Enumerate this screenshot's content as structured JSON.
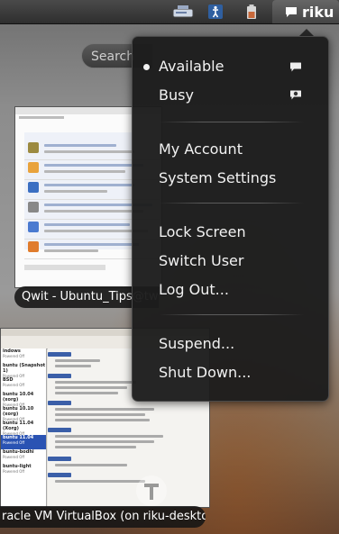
{
  "panel": {
    "user_name": "riku",
    "icons": [
      "network-icon",
      "accessibility-icon",
      "battery-icon",
      "chat-bubble-icon"
    ]
  },
  "search": {
    "placeholder": "Search"
  },
  "windows": [
    {
      "caption": "Qwit - Ubuntu_Tips@twit"
    },
    {
      "caption": "racle VM VirtualBox (on riku-desktop)"
    }
  ],
  "menu": {
    "status_items": [
      {
        "label": "Available",
        "selected": true,
        "icon": "chat-bubble-icon"
      },
      {
        "label": "Busy",
        "selected": false,
        "icon": "busy-bubble-icon"
      }
    ],
    "account_items": [
      {
        "label": "My Account"
      },
      {
        "label": "System Settings"
      }
    ],
    "session_items": [
      {
        "label": "Lock Screen"
      },
      {
        "label": "Switch User"
      },
      {
        "label": "Log Out..."
      }
    ],
    "power_items": [
      {
        "label": "Suspend..."
      },
      {
        "label": "Shut Down..."
      }
    ]
  },
  "vbox_list": [
    {
      "name": "indows",
      "state": "Powered Off"
    },
    {
      "name": "buntu (Snapshot 1)",
      "state": "Powered Off"
    },
    {
      "name": "BSD",
      "state": "Powered Off"
    },
    {
      "name": "buntu 10.04 (xorg)",
      "state": "Powered Off"
    },
    {
      "name": "buntu 10.10 (xorg)",
      "state": "Powered Off"
    },
    {
      "name": "buntu 11.04 (Xorg)",
      "state": "Powered Off"
    },
    {
      "name": "buntu 11.04",
      "state": "Powered Off"
    },
    {
      "name": "buntu-bodhi",
      "state": "Powered Off"
    },
    {
      "name": "buntu-light",
      "state": "Powered Off"
    }
  ]
}
